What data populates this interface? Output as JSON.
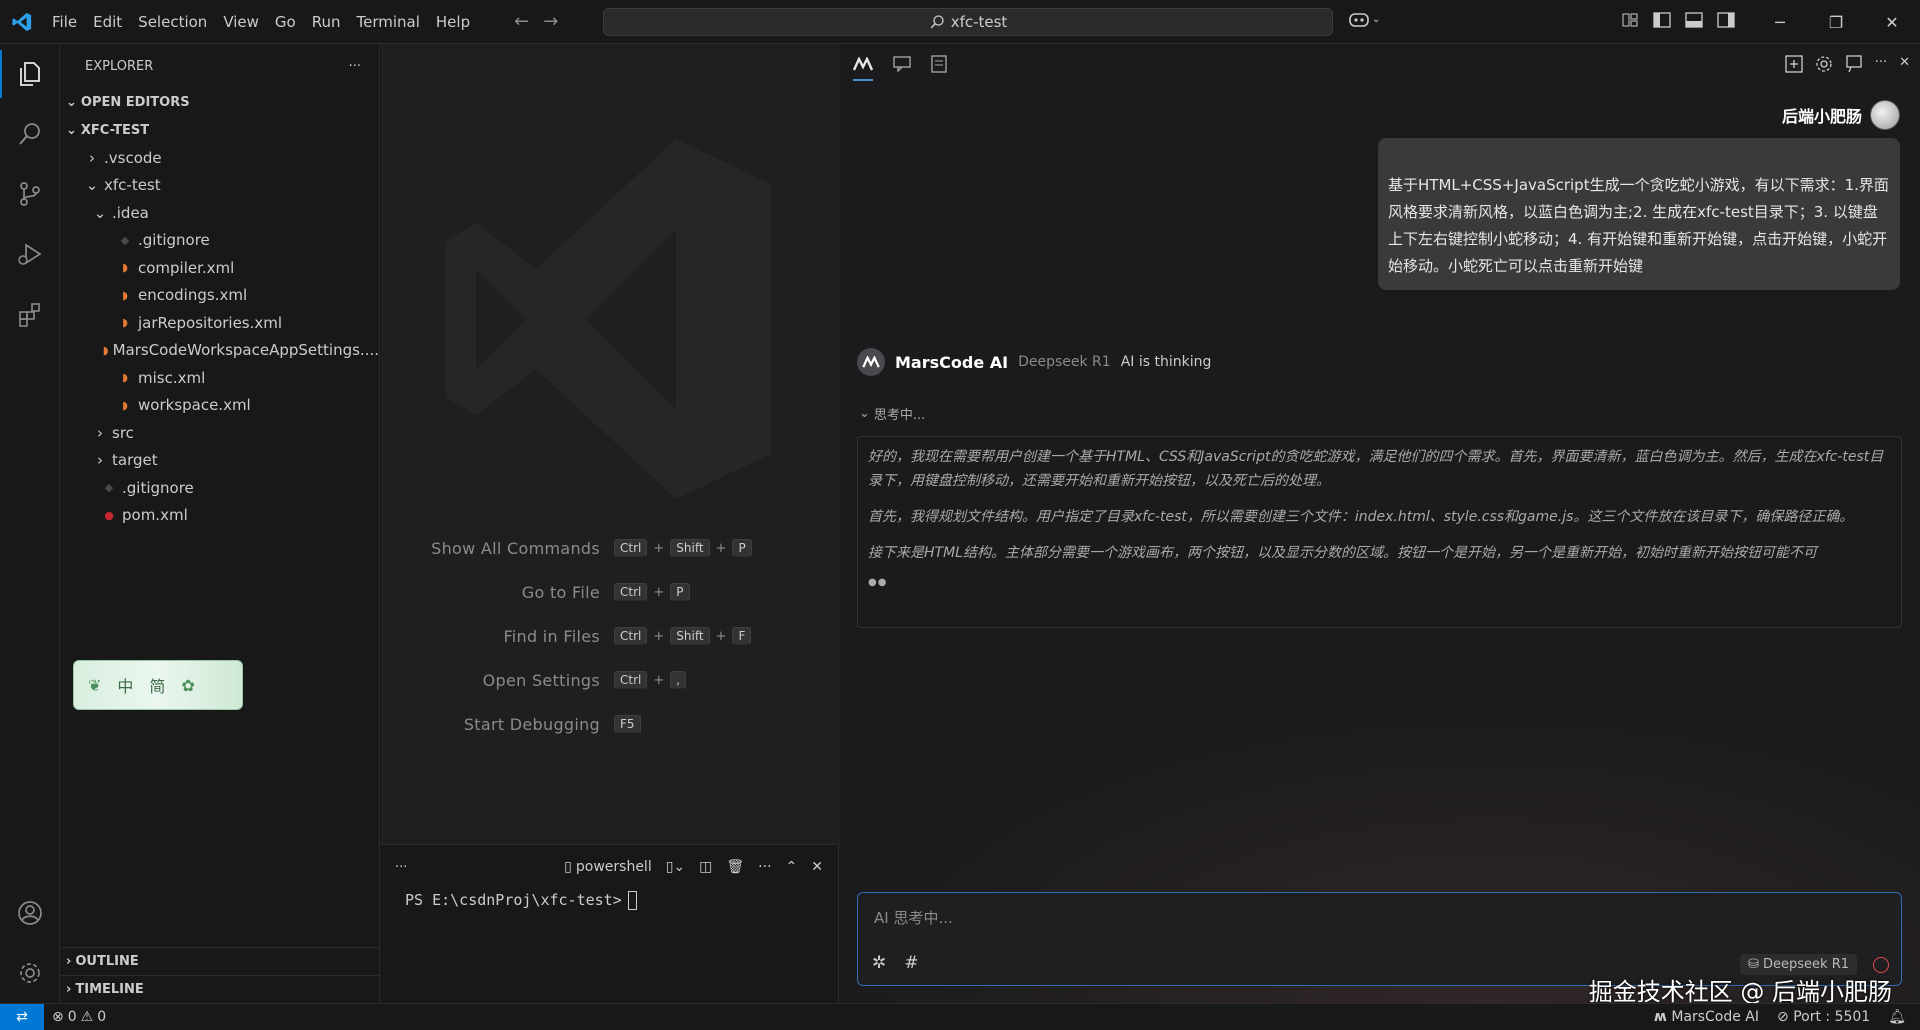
{
  "menu": [
    "File",
    "Edit",
    "Selection",
    "View",
    "Go",
    "Run",
    "Terminal",
    "Help"
  ],
  "search": {
    "text": "xfc-test"
  },
  "explorer": {
    "title": "EXPLORER",
    "more": "···",
    "open_editors": "OPEN EDITORS",
    "project": "XFC-TEST",
    "tree": [
      {
        "label": ".vscode",
        "type": "folder-closed"
      },
      {
        "label": "xfc-test",
        "type": "folder-open"
      },
      {
        "label": ".idea",
        "type": "folder-open"
      },
      {
        "label": ".gitignore",
        "type": "gitignore"
      },
      {
        "label": "compiler.xml",
        "type": "xml"
      },
      {
        "label": "encodings.xml",
        "type": "xml"
      },
      {
        "label": "jarRepositories.xml",
        "type": "xml"
      },
      {
        "label": "MarsCodeWorkspaceAppSettings....",
        "type": "xml"
      },
      {
        "label": "misc.xml",
        "type": "xml"
      },
      {
        "label": "workspace.xml",
        "type": "xml"
      },
      {
        "label": "src",
        "type": "folder-closed"
      },
      {
        "label": "target",
        "type": "folder-closed"
      },
      {
        "label": ".gitignore",
        "type": "gitignore"
      },
      {
        "label": "pom.xml",
        "type": "maven"
      }
    ],
    "outline": "OUTLINE",
    "timeline": "TIMELINE"
  },
  "ime": {
    "char1": "中",
    "char2": "简"
  },
  "shortcuts": [
    {
      "label": "Show All Commands",
      "keys": [
        "Ctrl",
        "Shift",
        "P"
      ]
    },
    {
      "label": "Go to File",
      "keys": [
        "Ctrl",
        "P"
      ]
    },
    {
      "label": "Find in Files",
      "keys": [
        "Ctrl",
        "Shift",
        "F"
      ]
    },
    {
      "label": "Open Settings",
      "keys": [
        "Ctrl",
        ","
      ]
    },
    {
      "label": "Start Debugging",
      "keys": [
        "F5"
      ]
    }
  ],
  "terminal": {
    "more": "···",
    "shell": "powershell",
    "prompt": "PS E:\\csdnProj\\xfc-test>"
  },
  "ai": {
    "username": "后端小肥肠",
    "user_message": "基于HTML+CSS+JavaScript生成一个贪吃蛇小游戏，有以下需求：1.界面风格要求清新风格，以蓝白色调为主;2. 生成在xfc-test目录下；3. 以键盘上下左右键控制小蛇移动；4. 有开始键和重新开始键，点击开始键，小蛇开始移动。小蛇死亡可以点击重新开始键",
    "assistant_name": "MarsCode AI",
    "model": "Deepseek R1",
    "status": "AI is thinking",
    "thinking_label": "思考中...",
    "thinking": [
      "好的，我现在需要帮用户创建一个基于HTML、CSS和JavaScript的贪吃蛇游戏，满足他们的四个需求。首先，界面要清新，蓝白色调为主。然后，生成在xfc-test目录下，用键盘控制移动，还需要开始和重新开始按钮，以及死亡后的处理。",
      "首先，我得规划文件结构。用户指定了目录xfc-test，所以需要创建三个文件：index.html、style.css和game.js。这三个文件放在该目录下，确保路径正确。",
      "接下来是HTML结构。主体部分需要一个游戏画布，两个按钮，以及显示分数的区域。按钮一个是开始，另一个是重新开始，初始时重新开始按钮可能不可"
    ],
    "input_placeholder": "AI 思考中...",
    "model_pill": "Deepseek R1"
  },
  "watermark": "掘金技术社区 @ 后端小肥肠",
  "status": {
    "errors": "0",
    "warnings": "0",
    "marscode": "MarsCode AI",
    "port": "Port : 5501"
  },
  "colors": {
    "accent": "#0078d4",
    "input_border": "#2f6fb1",
    "stop": "#e04a4a"
  }
}
